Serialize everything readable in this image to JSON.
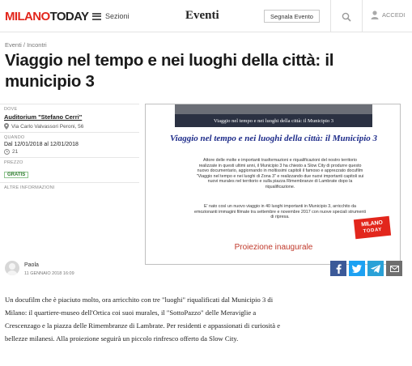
{
  "header": {
    "logo_part1": "MILANO",
    "logo_part2": "TODAY",
    "menu_label": "Sezioni",
    "section_title": "Eventi",
    "report_label": "Segnala Evento",
    "login_label": "ACCEDI"
  },
  "breadcrumb": "Eventi / Incontri",
  "title": "Viaggio nel tempo e nei luoghi della città: il municipio 3",
  "info": {
    "where_label": "DOVE",
    "venue": "Auditorium \"Stefano Cerri\"",
    "address": "Via Carlo Valvassori Peroni, 56",
    "when_label": "QUANDO",
    "dates": "Dal 12/01/2018 al 12/01/2018",
    "time": "21",
    "price_label": "PREZZO",
    "price": "GRATIS",
    "more_label": "ALTRE INFORMAZIONI"
  },
  "image": {
    "top_text": "Viaggio nel tempo e nei luoghi della città: il Municipio 3",
    "title": "Viaggio nel tempo e nei luoghi della città: il Municipio 3",
    "para1": "Attore delle molte e importanti trasformazioni e riqualificazioni del nostro territorio realizzate in questi ultimi anni, il Municipio 3 ha chiesto a Slow City di produrre questo nuovo documentario, aggiornando in moltissimi capitoli il famoso e apprezzato docufilm \"Viaggio nel tempo e nei luoghi di Zona 3\" e realizzando due nuovi importanti capitoli sui nuovi murales nel territorio e sulla piazza Rimembranze di Lambrate dopo la riqualificazione.",
    "para2": "E' nato così un nuovo viaggio in 40 luoghi importanti in Municipio 3, arricchito da emozionanti immagini filmate tra settembre e novembre 2017 con nuove speciali strumenti di ripresa.",
    "logo_part1": "MILANO",
    "logo_part2": "TODAY",
    "projection": "Proiezione inaugurale"
  },
  "author": {
    "name": "Paola",
    "date": "11 GENNAIO 2018 16:09"
  },
  "body_text": "Un docufilm che è piaciuto molto, ora arricchito con tre \"luoghi\" riqualificati dal Municipio 3 di Milano: il quartiere-museo dell'Ortica coi suoi murales, il \"SottoPazzo\" delle Meraviglie a Crescenzago e la piazza delle Rimembranze di Lambrate. Per residenti e appassionati di curiosità e bellezze milanesi. Alla proiezione seguirà un piccolo rinfresco offerto da Slow City.",
  "colors": {
    "brand_red": "#e2261c",
    "facebook": "#3b5998",
    "twitter": "#1da1f2",
    "telegram": "#2aa1d7",
    "email": "#6e6e6e"
  },
  "icons": [
    "menu-icon",
    "search-icon",
    "user-icon",
    "map-pin-icon",
    "clock-icon",
    "facebook-icon",
    "twitter-icon",
    "telegram-icon",
    "email-icon"
  ]
}
